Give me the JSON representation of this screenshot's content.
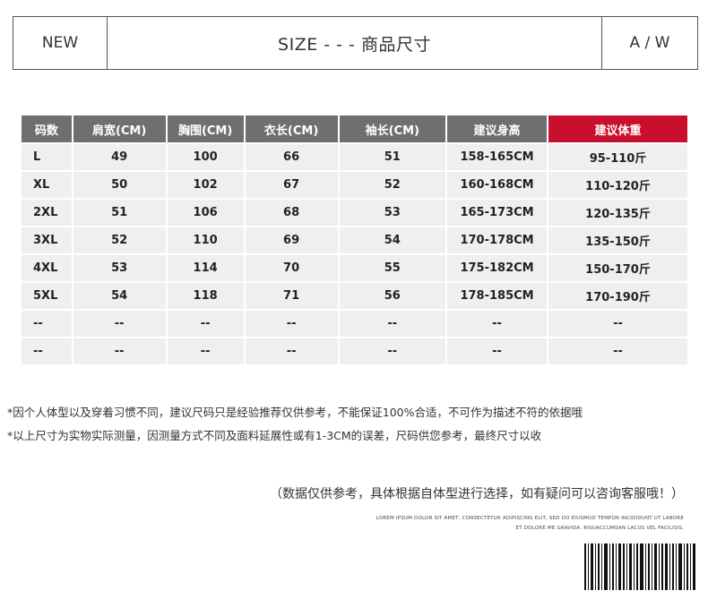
{
  "header": {
    "left": "NEW",
    "title": "SIZE - - -  商品尺寸",
    "right": "A / W"
  },
  "table": {
    "headers": [
      "码数",
      "肩宽(CM)",
      "胸围(CM)",
      "衣长(CM)",
      "袖长(CM)",
      "建议身高",
      "建议体重"
    ],
    "highlight_color": "#c8102e",
    "header_color": "#6f6f6f",
    "rows": [
      [
        "L",
        "49",
        "100",
        "66",
        "51",
        "158-165CM",
        "95-110斤"
      ],
      [
        "XL",
        "50",
        "102",
        "67",
        "52",
        "160-168CM",
        "110-120斤"
      ],
      [
        "2XL",
        "51",
        "106",
        "68",
        "53",
        "165-173CM",
        "120-135斤"
      ],
      [
        "3XL",
        "52",
        "110",
        "69",
        "54",
        "170-178CM",
        "135-150斤"
      ],
      [
        "4XL",
        "53",
        "114",
        "70",
        "55",
        "175-182CM",
        "150-170斤"
      ],
      [
        "5XL",
        "54",
        "118",
        "71",
        "56",
        "178-185CM",
        "170-190斤"
      ],
      [
        "--",
        "--",
        "--",
        "--",
        "--",
        "--",
        "--"
      ],
      [
        "--",
        "--",
        "--",
        "--",
        "--",
        "--",
        "--"
      ]
    ]
  },
  "notes": [
    "*因个人体型以及穿着习惯不同，建议尺码只是经验推荐仅供参考，不能保证100%合适，不可作为描述不符的依据哦",
    "*以上尺寸为实物实际测量，因测量方式不同及面料延展性或有1-3CM的误差，尺码供您参考，最终尺寸以收"
  ],
  "tagline": "（数据仅供参考，具体根据自体型进行选择，如有疑问可以咨询客服哦！）",
  "lorem": [
    "LOREM IPSUM DOLOR SIT AMET, CONSECTETUR ADIPISCING ELIT, SED DO EIUSMOD TEMPOR INCIDIDUNT UT LABORE",
    "ET DOLORE ME GRAVIDA. RISUACCUMSAN LACUS VEL FACILISIS."
  ]
}
